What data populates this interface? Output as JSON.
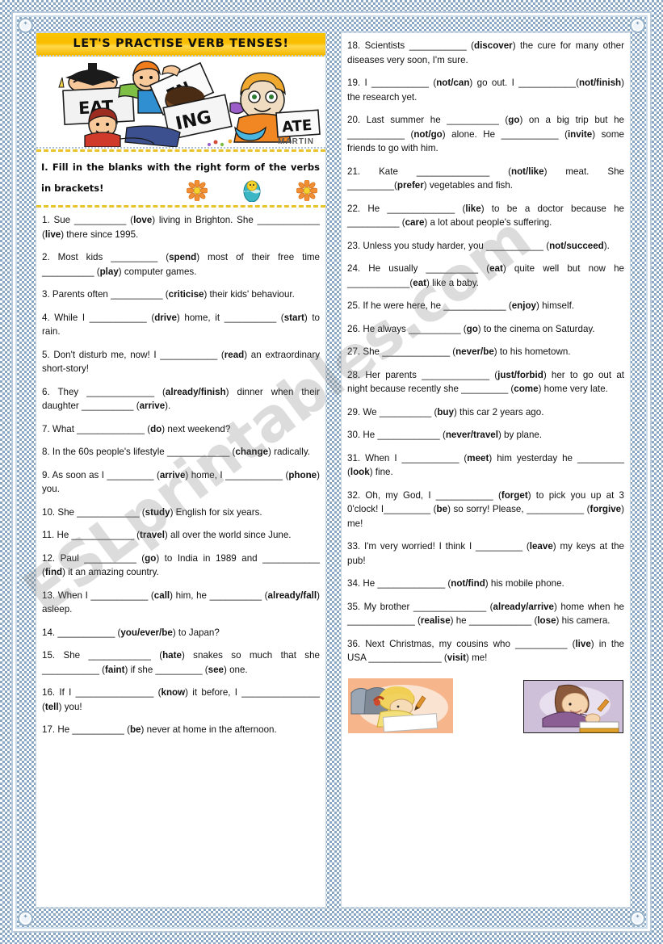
{
  "page": {
    "title_banner": "LET'S PRACTISE VERB TENSES!",
    "clipart_signature": "MARTIN",
    "watermark": "ESLprintables.com",
    "accent_gold": "#f9bd00",
    "accent_border_blue": "#8aa8c4",
    "dashed_yellow": "#e8c32a"
  },
  "instruction": {
    "text": "I. Fill in the blanks with the right form of the verbs in brackets!"
  },
  "left_column": {
    "items": [
      "1. Sue __________ (love) living in Brighton. She ____________ (live) there since 1995.",
      "2. Most kids _________ (spend) most of their free time __________ (play) computer games.",
      "3. Parents often __________ (criticise) their kids' behaviour.",
      "4. While I ___________ (drive) home, it __________ (start) to rain.",
      "5. Don't disturb me, now! I ___________ (read) an extraordinary short-story!",
      "6. They _____________ (already/finish) dinner when their daughter __________ (arrive).",
      "7. What _____________ (do) next weekend?",
      "8. In the 60s people's lifestyle ____________ (change) radically.",
      "9. As soon as I _________ (arrive) home, I ___________ (phone) you.",
      "10. She ____________ (study) English for six years.",
      "11. He ____________ (travel) all over the world since June.",
      "12. Paul __________ (go) to India in 1989 and ___________ (find) it an amazing country.",
      "13. When I ___________ (call) him, he __________ (already/fall) asleep.",
      "14. ___________ (you/ever/be) to Japan?",
      "15. She ____________ (hate) snakes so much that she ___________ (faint) if she _________ (see) one.",
      "16. If I _______________ (know) it before, I _______________ (tell) you!",
      "17. He __________ (be) never at home in the afternoon."
    ]
  },
  "right_column": {
    "items": [
      "18. Scientists ___________ (discover) the cure for many other diseases very soon, I'm sure.",
      "19. I ___________ (not/can) go out. I ___________(not/finish) the research yet.",
      "20. Last summer he __________ (go) on a big trip but he ___________ (not/go) alone. He ___________ (invite) some friends to go with him.",
      "21. Kate ______________ (not/like) meat. She _________(prefer) vegetables and fish.",
      "22. He _____________ (like) to be a doctor because he __________ (care) a lot about people's suffering.",
      "23. Unless you study harder, you ___________ (not/succeed).",
      "24. He usually __________ (eat) quite well but now he ____________(eat) like a baby.",
      "25. If he were here, he ____________ (enjoy) himself.",
      "26. He always __________ (go) to the cinema on Saturday.",
      "27. She _____________ (never/be) to his hometown.",
      "28. Her parents _____________ (just/forbid) her to go out at night because recently she _________ (come) home very late.",
      "29. We __________ (buy) this car 2 years ago.",
      "30. He ____________ (never/travel) by plane.",
      "31. When I ___________ (meet) him yesterday he _________ (look) fine.",
      "32. Oh, my God, I ___________ (forget) to pick you up at 3 0'clock! I_________ (be) so sorry! Please, ___________ (forgive) me!",
      "33. I'm very worried! I think I _________ (leave) my keys at the pub!",
      "34. He _____________ (not/find) his mobile phone.",
      "35. My brother ______________ (already/arrive) home when he _____________ (realise) he ____________ (lose) his camera.",
      "36. Next Christmas, my cousins who __________ (live) in the USA ______________ (visit) me!"
    ],
    "bottom_images": [
      {
        "name": "girl-writing-clipart",
        "bg": "#f6b58a"
      },
      {
        "name": "boy-writing-clipart",
        "bg": "#cfc0da"
      }
    ]
  },
  "corner_ornaments": [
    "corner-top-left",
    "corner-top-right",
    "corner-bottom-left",
    "corner-bottom-right"
  ]
}
